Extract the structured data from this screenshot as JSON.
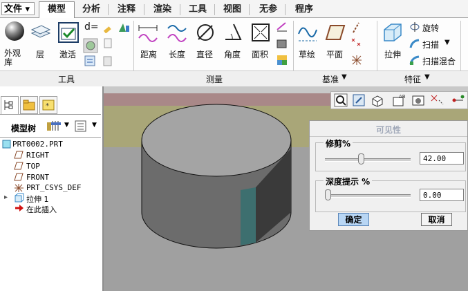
{
  "menu": {
    "file_label": "文件 ▾",
    "tabs": [
      {
        "label": "模型",
        "active": true
      },
      {
        "label": "分析"
      },
      {
        "label": "注释"
      },
      {
        "label": "渲染"
      },
      {
        "label": "工具"
      },
      {
        "label": "视图"
      },
      {
        "label": "无参"
      },
      {
        "label": "程序"
      }
    ]
  },
  "ribbon": {
    "buttons": {
      "appearance": "外观",
      "appearance_lib": "库",
      "layer": "层",
      "activate": "激活",
      "distance": "距离",
      "length": "长度",
      "diameter": "直径",
      "angle": "角度",
      "area": "面积",
      "sketch": "草绘",
      "plane": "平面",
      "extrude": "拉伸",
      "revolve": "旋转",
      "sweep": "扫描",
      "swept_blend": "扫描混合",
      "d_equals": "d="
    },
    "groups": {
      "tools": "工具",
      "measure": "测量",
      "datum": "基准",
      "feature": "特征"
    }
  },
  "tree": {
    "title": "模型树",
    "items": [
      {
        "label": "PRT0002.PRT"
      },
      {
        "label": "RIGHT"
      },
      {
        "label": "TOP"
      },
      {
        "label": "FRONT"
      },
      {
        "label": "PRT_CSYS_DEF"
      },
      {
        "label": "拉伸 1"
      },
      {
        "label": "在此插入"
      }
    ]
  },
  "dialog": {
    "title": "可见性",
    "trim": {
      "label": "修剪%",
      "value": "42.00",
      "fraction": 0.42
    },
    "depth": {
      "label": "深度提示 %",
      "value": "0.00",
      "fraction": 0.0
    },
    "ok": "确定",
    "cancel": "取消"
  },
  "colors": {
    "accent_tab_border": "#8a8a8a",
    "viewport_olive": "#a9a678",
    "viewport_rose": "#a98888",
    "cylinder_top": "#a4a4a4",
    "cylinder_side": "#6c6c6c",
    "cylinder_highlight": "#3d6f6f",
    "ok_button": "#b8d6f4"
  }
}
